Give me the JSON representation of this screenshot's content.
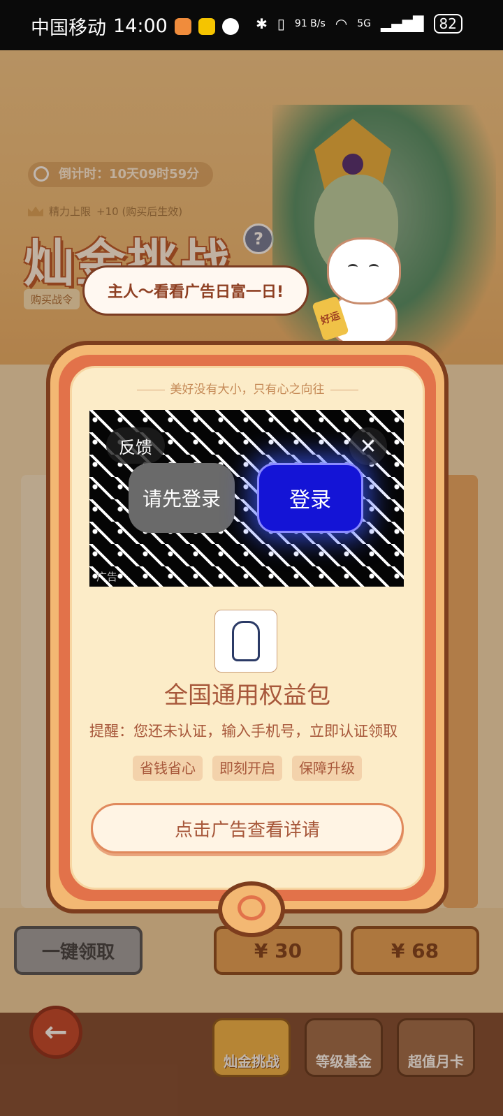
{
  "status_bar": {
    "carrier": "中国移动",
    "time": "14:00",
    "net_speed": "91 B/s",
    "signal": "5G",
    "battery": "82"
  },
  "game": {
    "countdown": "倒计时：10天09时59分",
    "energy_cap": "精力上限",
    "energy_bonus": "+10 (购买后生效)",
    "title": "灿金挑战",
    "help": "?",
    "buy_token": "购买战令",
    "mascot_speech": "主人～看看广告日富一日!",
    "mascot_scroll": "好运",
    "claim_all": "一键领取",
    "price_1": "¥ 30",
    "price_2": "¥ 68",
    "back": "←",
    "tabs": [
      "灿金挑战",
      "等级基金",
      "超值月卡"
    ]
  },
  "modal": {
    "motto": "美好没有大小，只有心之向往",
    "ad": {
      "feedback": "反馈",
      "close": "✕",
      "hint": "请先登录",
      "login": "登录",
      "tag": "广告"
    },
    "package_title": "全国通用权益包",
    "description": "提醒：您还未认证，输入手机号，立即认证领取",
    "tags": [
      "省钱省心",
      "即刻开启",
      "保障升级"
    ],
    "cta": "点击广告查看详请"
  }
}
